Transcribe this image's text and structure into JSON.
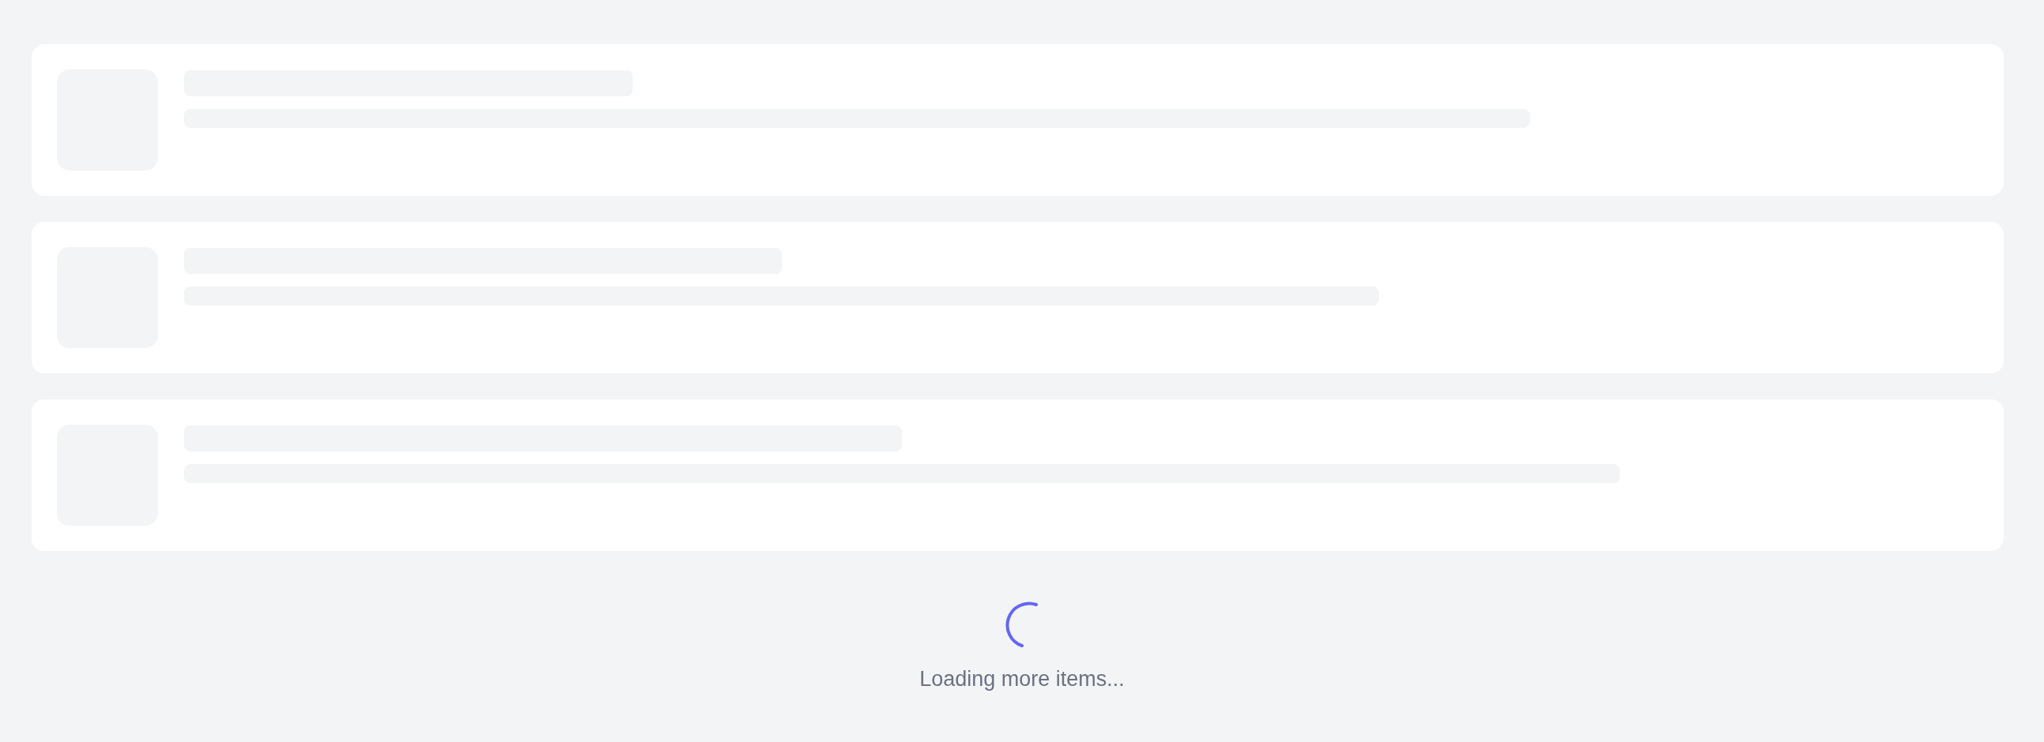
{
  "items": [
    {
      "kind": "skeleton"
    },
    {
      "kind": "skeleton"
    },
    {
      "kind": "skeleton"
    }
  ],
  "loading": {
    "spinner": true,
    "message": "Loading more items..."
  }
}
